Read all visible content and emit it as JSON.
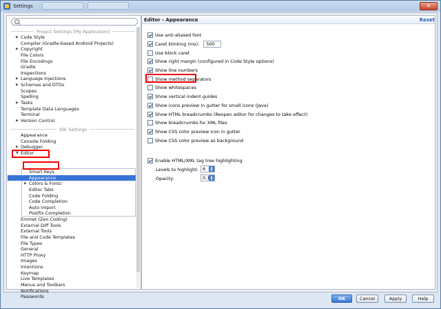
{
  "window": {
    "title": "Settings"
  },
  "search": {
    "value": "",
    "placeholder": ""
  },
  "sections": {
    "project": "Project Settings [My Application]",
    "ide": "IDE Settings"
  },
  "project_items": [
    {
      "label": "Code Style",
      "arrow": true
    },
    {
      "label": "Compiler (Gradle-based Android Projects)",
      "arrow": false
    },
    {
      "label": "Copyright",
      "arrow": true
    },
    {
      "label": "File Colors",
      "arrow": false
    },
    {
      "label": "File Encodings",
      "arrow": false
    },
    {
      "label": "Gradle",
      "arrow": false
    },
    {
      "label": "Inspections",
      "arrow": false
    },
    {
      "label": "Language Injections",
      "arrow": true
    },
    {
      "label": "Schemas and DTDs",
      "arrow": true
    },
    {
      "label": "Scopes",
      "arrow": false
    },
    {
      "label": "Spelling",
      "arrow": false
    },
    {
      "label": "Tasks",
      "arrow": true
    },
    {
      "label": "Template Data Languages",
      "arrow": false
    },
    {
      "label": "Terminal",
      "arrow": false
    },
    {
      "label": "Version Control",
      "arrow": true
    }
  ],
  "ide_items_top": [
    {
      "label": "Appearance",
      "arrow": false
    },
    {
      "label": "Console Folding",
      "arrow": false
    },
    {
      "label": "Debugger",
      "arrow": true
    },
    {
      "label": "Editor",
      "arrow": true,
      "expanded": true
    }
  ],
  "editor_children": [
    {
      "label": "Smart Keys",
      "arrow": false
    },
    {
      "label": "Appearance",
      "arrow": false,
      "selected": true
    },
    {
      "label": "Colors & Fonts",
      "arrow": true
    },
    {
      "label": "Editor Tabs",
      "arrow": false
    },
    {
      "label": "Code Folding",
      "arrow": false
    },
    {
      "label": "Code Completion",
      "arrow": false
    },
    {
      "label": "Auto Import",
      "arrow": false
    },
    {
      "label": "Postfix Completion",
      "arrow": false
    }
  ],
  "ide_items_bottom": [
    {
      "label": "Emmet (Zen Coding)",
      "arrow": false
    },
    {
      "label": "External Diff Tools",
      "arrow": false
    },
    {
      "label": "External Tools",
      "arrow": false
    },
    {
      "label": "File and Code Templates",
      "arrow": false
    },
    {
      "label": "File Types",
      "arrow": false
    },
    {
      "label": "General",
      "arrow": false
    },
    {
      "label": "HTTP Proxy",
      "arrow": false
    },
    {
      "label": "Images",
      "arrow": false
    },
    {
      "label": "Intentions",
      "arrow": false
    },
    {
      "label": "Keymap",
      "arrow": false
    },
    {
      "label": "Live Templates",
      "arrow": false
    },
    {
      "label": "Menus and Toolbars",
      "arrow": false
    },
    {
      "label": "Notifications",
      "arrow": false
    },
    {
      "label": "Passwords",
      "arrow": false
    }
  ],
  "right": {
    "breadcrumb": "Editor › Appearance",
    "reset_label": "Reset"
  },
  "options": [
    {
      "label": "Use anti-aliased font",
      "checked": true
    },
    {
      "label": "Caret blinking (ms):",
      "checked": true,
      "value": "500"
    },
    {
      "label": "Use block caret",
      "checked": false
    },
    {
      "label": "Show right margin (configured in Code Style options)",
      "checked": true
    },
    {
      "label": "Show line numbers",
      "checked": true
    },
    {
      "label": "Show method separators",
      "checked": false
    },
    {
      "label": "Show whitespaces",
      "checked": false
    },
    {
      "label": "Show vertical indent guides",
      "checked": true
    },
    {
      "label": "Show icons preview in gutter for small icons (Java)",
      "checked": true
    },
    {
      "label": "Show HTML breadcrumbs (Reopen editor for changes to take effect)",
      "checked": true
    },
    {
      "label": "Show breadcrumbs for XML files",
      "checked": false
    },
    {
      "label": "Show CSS color preview icon in gutter",
      "checked": true
    },
    {
      "label": "Show CSS color preview as background",
      "checked": false
    }
  ],
  "tag_highlight": {
    "label": "Enable HTML/XML tag tree highlighting",
    "checked": true,
    "levels_label": "Levels to highlight:",
    "levels_value": "6",
    "opacity_label": "Opacity:",
    "opacity_value": "0.1"
  },
  "buttons": {
    "ok": "OK",
    "cancel": "Cancel",
    "apply": "Apply",
    "help": "Help"
  },
  "colors": {
    "selection": "#3875d7",
    "highlight_box": "#e00000",
    "reset_link": "#2561b2"
  }
}
